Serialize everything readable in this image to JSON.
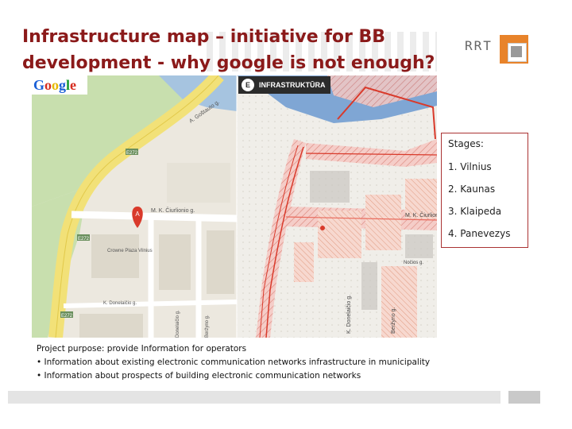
{
  "title": {
    "line1": "Infrastructure map – initiative for BB",
    "line2": "development - why google is not enough?"
  },
  "logo": {
    "text": "RRT"
  },
  "map": {
    "google_logo": "Google",
    "badge_icon": "E",
    "badge_text": "INFRASTRUKTŪRA",
    "labels": {
      "road_a": "A. Goštauto g.",
      "street_left": "M. K. Čiurlionio g.",
      "street_right": "M. K. Čiurlionio g.",
      "hotel": "Crowne Plaza Vilnius",
      "k_donelaicio": "K. Donelaičio g.",
      "donelaicio_v": "Donelaičio g.",
      "berzyno": "Beržyno g.",
      "berzyno2": "Beržyno g.",
      "k_donelaicio_v": "K. Donelaičio g.",
      "nocios": "Nočios g.",
      "marker": "A",
      "route1": "E272",
      "route2": "E272",
      "route3": "E272"
    }
  },
  "stages": {
    "title": "Stages:",
    "items": [
      "1. Vilnius",
      "2. Kaunas",
      "3. Klaipeda",
      "4. Panevezys"
    ]
  },
  "purpose": {
    "heading": "Project purpose: provide Information for operators",
    "bullets": [
      "• Information about existing electronic communication networks infrastructure in municipality",
      "• Information about prospects of building electronic communication networks"
    ]
  }
}
